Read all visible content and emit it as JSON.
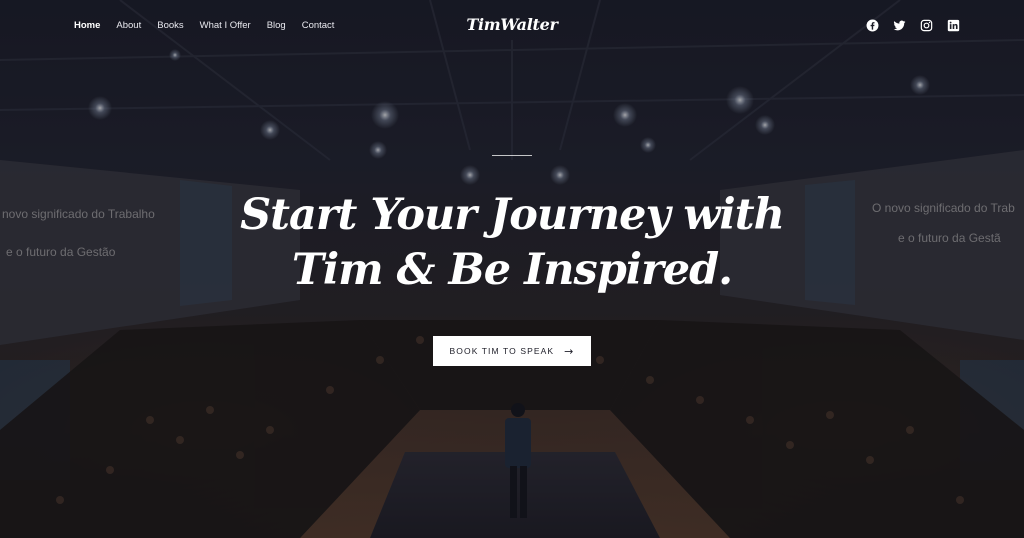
{
  "nav": {
    "items": [
      {
        "label": "Home",
        "active": true
      },
      {
        "label": "About"
      },
      {
        "label": "Books"
      },
      {
        "label": "What I Offer"
      },
      {
        "label": "Blog"
      },
      {
        "label": "Contact"
      }
    ]
  },
  "brand": {
    "logo": "TimWalter"
  },
  "social": [
    "facebook-icon",
    "twitter-icon",
    "instagram-icon",
    "linkedin-icon"
  ],
  "hero": {
    "headline_line1": "Start Your Journey with",
    "headline_line2": "Tim & Be Inspired.",
    "cta_label": "BOOK TIM TO SPEAK",
    "cta_icon": "arrow-right-icon"
  },
  "screens": {
    "left_line1": "novo significado do Trabalho",
    "left_line2": "e o futuro da Gestão",
    "right_line1": "O novo significado do Trab",
    "right_line2": "e o futuro da Gestã"
  },
  "colors": {
    "cta_bg": "#ffffff",
    "cta_text": "#1d1d27",
    "text": "#ffffff",
    "background": "#1a1c28"
  }
}
